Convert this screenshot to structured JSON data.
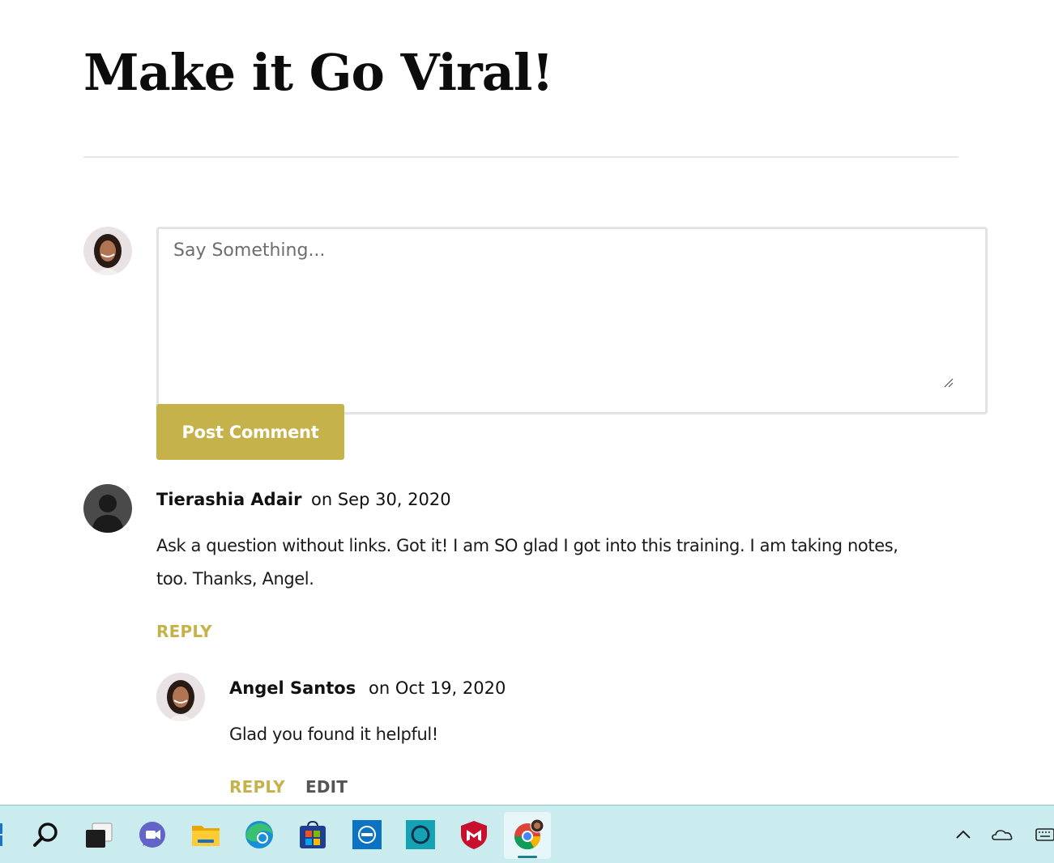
{
  "page": {
    "title": "Make it Go Viral!"
  },
  "comment_form": {
    "placeholder": "Say Something...",
    "post_button_label": "Post Comment"
  },
  "comments": [
    {
      "author": "Tierashia Adair",
      "date": "on Sep 30, 2020",
      "text_line_1": "Ask a question without links. Got it! I am SO glad I got into this training. I am taking notes,",
      "text_line_2": "too. Thanks, Angel.",
      "reply_label": "REPLY"
    },
    {
      "author": "Angel Santos",
      "date": "on Oct 19, 2020",
      "text": "Glad you found it helpful!",
      "reply_label": "REPLY",
      "edit_label": "EDIT"
    }
  ],
  "colors": {
    "accent": "#c5b24b",
    "edit": "#555555",
    "taskbar": "#cbecef"
  },
  "taskbar": {
    "icons": [
      "start-icon",
      "search-icon",
      "task-view-icon",
      "teams-chat-icon",
      "file-explorer-icon",
      "edge-icon",
      "store-icon",
      "dell-icon",
      "alexa-icon",
      "mcafee-icon",
      "chrome-icon"
    ],
    "tray": [
      "chevron-up-icon",
      "onedrive-icon",
      "keyboard-icon"
    ]
  }
}
